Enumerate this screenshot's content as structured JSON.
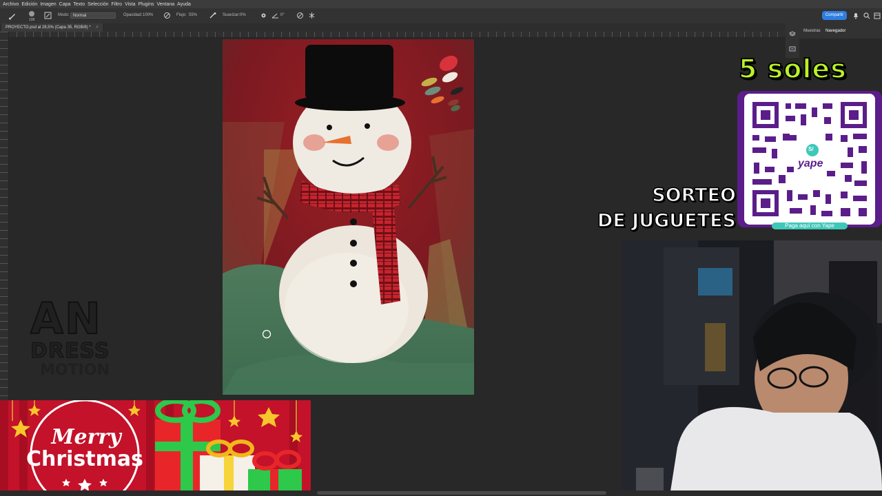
{
  "menu": [
    "Archivo",
    "Edición",
    "Imagen",
    "Capa",
    "Texto",
    "Selección",
    "Filtro",
    "Vista",
    "Plugins",
    "Ventana",
    "Ayuda"
  ],
  "options": {
    "brush_size": "108",
    "mode_label": "Modo:",
    "mode_value": "Normal",
    "opacity_label": "Opacidad:",
    "opacity_value": "100%",
    "flow_label": "Flujo:",
    "flow_value": "55%",
    "smoothing_label": "Suavizar:",
    "smoothing_value": "0%",
    "angle_value": "0°",
    "share_label": "Compartir"
  },
  "document": {
    "tab_title": "PROYECTO.psd al 28,5% (Capa 35, RGB/8) *"
  },
  "panels": {
    "tab_samples": "Muestras",
    "tab_navigator": "Navegador"
  },
  "overlay": {
    "price": "5 soles",
    "raffle_line1": "SORTEO",
    "raffle_line2": "DE JUGUETES",
    "qr_caption": "Paga aquí con Yape",
    "qr_brand": "yape",
    "qr_symbol": "S/",
    "logo_line1": "AN",
    "logo_line2": "DRESS",
    "logo_line3": "MOTION",
    "banner_line1": "Merry",
    "banner_line2": "Christmas"
  },
  "colors": {
    "accent_blue": "#2f7de0",
    "price_green": "#b8f227",
    "qr_purple": "#5b1d8a",
    "banner_red": "#c3122a"
  }
}
